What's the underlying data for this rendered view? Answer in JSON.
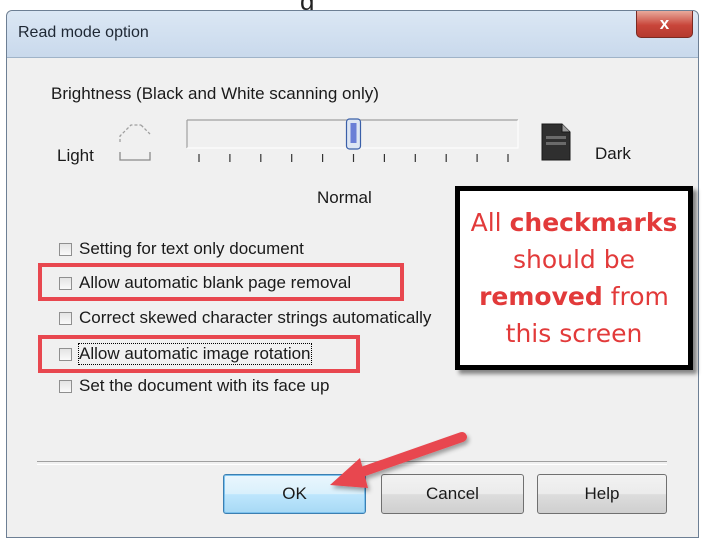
{
  "page_top_fragment": "g",
  "window": {
    "title": "Read mode option",
    "close_label": "x"
  },
  "brightness": {
    "label": "Brightness (Black and White scanning only)",
    "light_label": "Light",
    "dark_label": "Dark",
    "normal_label": "Normal",
    "level_fraction": 0.5
  },
  "options": [
    {
      "label": "Setting for text only document",
      "checked": false,
      "highlighted": false
    },
    {
      "label": "Allow automatic blank page removal",
      "checked": false,
      "highlighted": true
    },
    {
      "label": "Correct skewed character strings automatically",
      "checked": false,
      "highlighted": false
    },
    {
      "label": "Allow automatic image rotation",
      "checked": false,
      "highlighted": true,
      "focused": true
    },
    {
      "label": "Set the document with its face up",
      "checked": false,
      "highlighted": false
    }
  ],
  "annotation": {
    "line1_prefix": "All ",
    "line1_bold": "checkmarks",
    "line2": "should be",
    "line3_bold": "removed",
    "line3_suffix": " from",
    "line4": "this screen"
  },
  "buttons": {
    "ok": "OK",
    "cancel": "Cancel",
    "help": "Help"
  },
  "colors": {
    "annotation_red": "#e23a3a",
    "highlight_box": "#e8474f",
    "arrow": "#e8474f"
  }
}
